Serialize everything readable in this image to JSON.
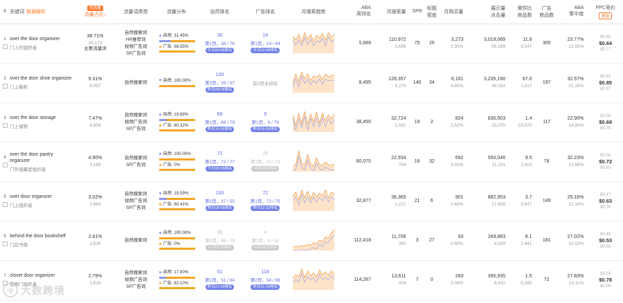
{
  "header": {
    "col_idx": "#",
    "col_keyword": "关键词",
    "col_keyword_link": "数据解析",
    "col_share_badge": "内流量",
    "col_share": "流量占比",
    "col_share_sort": "↓",
    "col_type": "流量词类型",
    "col_dist": "流量分布",
    "col_natural_rank": "自然排名",
    "col_ad_rank": "广告排名",
    "col_trend": "月搜索趋势",
    "col_aba": "ABA\n周排名",
    "col_search": "月搜索量",
    "col_spr": "SPR",
    "col_title_density": "标题\n密度",
    "col_purchase": "月购买量",
    "col_impressions": "展示量\n点击量",
    "col_product_ratio": "需供比\n商品数",
    "col_ad_products": "广告\n商品数",
    "col_aba_concentration": "ABA\n集中度",
    "col_ppc": "PPC竞价",
    "col_ppc_btn": "精准"
  },
  "rows": [
    {
      "idx": "1",
      "kw_en": "over the door organizer",
      "kw_cn": "门上的组织者",
      "share": "38.71%",
      "share_sub": "25,173",
      "share_note": "主要流量词",
      "types": [
        "自然搜索词",
        "HR推荐词",
        "视频广告词",
        "SP广告词"
      ],
      "nat_label": "自然: 31.45%",
      "ad_label": "广告: 68.55%",
      "nat_pct": 31.45,
      "nat_rank": "36",
      "nat_rank_page": "第1页，36 / 76",
      "nat_pill": "今日09:08排名",
      "ad_rank": "14",
      "ad_rank_page": "第1页，14 / 64",
      "ad_pill": "今日02:08排名",
      "trend": [
        18,
        14,
        20,
        12,
        22,
        15,
        20,
        13,
        19,
        16,
        21,
        14,
        22,
        17,
        20
      ],
      "aba": "5,689",
      "search": "110,972",
      "search_sub": "3,699",
      "spr": "75",
      "density": "25",
      "purchase": "3,273",
      "purchase_sub": "2.95%",
      "imp": "3,019,069",
      "imp_sub": "55,199",
      "ratio": "11.6",
      "ratio_sub": "9,547",
      "ad_products": "305",
      "conc": "23.77%",
      "conc_sub": "12.55%",
      "ppc_top": "$0.46",
      "ppc_mid": "$0.64",
      "ppc_bottom": "$0.77"
    },
    {
      "idx": "2",
      "kw_en": "over the door shoe organizer",
      "kw_cn": "门上鞋柜",
      "share": "9.31%",
      "share_sub": "6,057",
      "share_note": "",
      "types": [
        "自然搜索词"
      ],
      "nat_label": "自然: 100.00%",
      "ad_label": "",
      "nat_pct": 100,
      "nat_rank": "100",
      "nat_rank_page": "第3页，39 / 57",
      "nat_pill": "昨日08:08排名",
      "ad_rank": "",
      "ad_rank_page": "前3页无排名",
      "ad_pill": "",
      "trend": [
        10,
        20,
        12,
        22,
        15,
        20,
        13,
        18,
        16,
        19,
        14,
        20,
        17,
        18,
        19
      ],
      "aba": "8,495",
      "search": "128,357",
      "search_sub": "4,279",
      "spr": "140",
      "density": "34",
      "purchase": "6,161",
      "purchase_sub": "4.80%",
      "imp": "3,235,190",
      "imp_sub": "49,154",
      "ratio": "67.0",
      "ratio_sub": "1,917",
      "ad_products": "197",
      "conc": "32.57%",
      "conc_sub": "21.20%",
      "ppc_top": "$0.63",
      "ppc_mid": "$0.85",
      "ppc_bottom": "$0.97"
    },
    {
      "idx": "3",
      "kw_en": "over the door storage",
      "kw_cn": "门上储物",
      "share": "7.47%",
      "share_sub": "4,856",
      "share_note": "",
      "types": [
        "自然搜索词",
        "视频广告词",
        "SP广告词"
      ],
      "nat_label": "自然: 19.68%",
      "ad_label": "广告: 80.32%",
      "nat_pct": 19.68,
      "nat_rank": "68",
      "nat_rank_page": "第1页，68 / 79",
      "nat_pill": "昨日15:56排名",
      "ad_rank": "9",
      "ad_rank_page": "第1页，9 / 79",
      "ad_pill": "昨日15:56排名",
      "trend": [
        20,
        8,
        22,
        10,
        24,
        9,
        21,
        12,
        23,
        11,
        22,
        13,
        20,
        15,
        21
      ],
      "aba": "38,455",
      "search": "32,724",
      "search_sub": "1,091",
      "spr": "19",
      "density": "2",
      "purchase": "824",
      "purchase_sub": "2.52%",
      "imp": "830,503",
      "imp_sub": "15,075",
      "ratio": "1.4",
      "ratio_sub": "23,070",
      "ad_products": "117",
      "conc": "22.90%",
      "conc_sub": "14.80%",
      "ppc_top": "$0.56",
      "ppc_mid": "$0.69",
      "ppc_bottom": "$0.76"
    },
    {
      "idx": "4",
      "kw_en": "over the door pantry organizer",
      "kw_cn": "门外储藏室组织者",
      "share": "4.90%",
      "share_sub": "3,188",
      "share_note": "",
      "types": [
        "自然搜索词",
        "SP广告词"
      ],
      "nat_label": "自然: 100.00%",
      "ad_label": "广告: 0%",
      "nat_pct": 100,
      "nat_rank": "72",
      "nat_rank_page": "第1页，72 / 77",
      "nat_pill": "今日09:08排名",
      "ad_rank": "25",
      "ad_rank_page": "第1页，25 / 71",
      "ad_pill": "06月29日排名",
      "trend": [
        8,
        10,
        30,
        12,
        9,
        25,
        11,
        8,
        20,
        10,
        9,
        14,
        10,
        9,
        11
      ],
      "aba": "60,070",
      "search": "22,934",
      "search_sub": "764",
      "spr": "16",
      "density": "32",
      "purchase": "692",
      "purchase_sub": "3.02%",
      "imp": "550,046",
      "imp_sub": "11,101",
      "ratio": "9.5",
      "ratio_sub": "2,403",
      "ad_products": "78",
      "conc": "32.23%",
      "conc_sub": "12.68%",
      "ppc_top": "$0.58",
      "ppc_mid": "$0.72",
      "ppc_bottom": "$0.80"
    },
    {
      "idx": "5",
      "kw_en": "over door organizer",
      "kw_cn": "门上组织者",
      "share": "3.02%",
      "share_sub": "1,963",
      "share_note": "",
      "types": [
        "自然搜索词",
        "视频广告词",
        "SP广告词"
      ],
      "nat_label": "自然: 19.59%",
      "ad_label": "广告: 80.41%",
      "nat_pct": 19.59,
      "nat_rank": "100",
      "nat_rank_page": "第2页，37 / 55",
      "nat_pill": "昨日08:08排名",
      "ad_rank": "72",
      "ad_rank_page": "第1页，72 / 75",
      "ad_pill": "昨日22:32排名",
      "trend": [
        15,
        20,
        12,
        22,
        14,
        21,
        13,
        20,
        15,
        19,
        16,
        22,
        14,
        20,
        18
      ],
      "aba": "32,877",
      "search": "36,365",
      "search_sub": "1,212",
      "spr": "21",
      "density": "6",
      "purchase": "901",
      "purchase_sub": "2.48%",
      "imp": "882,953",
      "imp_sub": "17,456",
      "ratio": "3.7",
      "ratio_sub": "9,847",
      "ad_products": "149",
      "conc": "25.16%",
      "conc_sub": "12.15%",
      "ppc_top": "$0.47",
      "ppc_mid": "$0.63",
      "ppc_bottom": "$0.76"
    },
    {
      "idx": "6",
      "kw_en": "behind the door bookshelf",
      "kw_cn": "门后书架",
      "share": "2.81%",
      "share_sub": "1,826",
      "share_note": "",
      "types": [
        "自然搜索词"
      ],
      "nat_label": "自然: 100.00%",
      "ad_label": "广告: 0%",
      "nat_pct": 100,
      "nat_rank": "65",
      "nat_rank_page": "第1页，65 / 79",
      "nat_pill": "07月01日排名",
      "ad_rank": "4",
      "ad_rank_page": "第1页，4 / 53",
      "ad_pill": "06月19日排名",
      "trend": [
        4,
        5,
        4,
        6,
        5,
        7,
        6,
        9,
        8,
        12,
        10,
        16,
        14,
        20,
        24
      ],
      "aba": "112,418",
      "search": "11,706",
      "search_sub": "390",
      "spr": "3",
      "density": "27",
      "purchase": "93",
      "purchase_sub": "0.80%",
      "imp": "269,883",
      "imp_sub": "4,929",
      "ratio": "8.1",
      "ratio_sub": "1,441",
      "ad_products": "181",
      "conc": "27.02%",
      "conc_sub": "10.52%",
      "ppc_top": "$0.48",
      "ppc_mid": "$0.53",
      "ppc_bottom": "$0.59"
    },
    {
      "idx": "7",
      "kw_en": "closet door organizer",
      "kw_cn": "壁橱门组织者",
      "share": "2.79%",
      "share_sub": "1,816",
      "share_note": "",
      "types": [
        "自然搜索词",
        "视频广告词",
        "SP广告词"
      ],
      "nat_label": "自然: 17.90%",
      "ad_label": "广告: 82.10%",
      "nat_pct": 17.9,
      "nat_rank": "51",
      "nat_rank_page": "第1页，51 / 64",
      "nat_pill": "昨日21:34排名",
      "ad_rank": "118",
      "ad_rank_page": "第2页，54 / 56",
      "ad_pill": "昨日21:34排名",
      "trend": [
        12,
        16,
        14,
        22,
        13,
        20,
        15,
        18,
        14,
        21,
        16,
        19,
        15,
        20,
        17
      ],
      "aba": "114,287",
      "search": "13,611",
      "search_sub": "454",
      "spr": "7",
      "density": "0",
      "purchase": "283",
      "purchase_sub": "2.08%",
      "imp": "395,935",
      "imp_sub": "6,432",
      "ratio": "1.5",
      "ratio_sub": "9,392",
      "ad_products": "72",
      "conc": "27.83%",
      "conc_sub": "13.11%",
      "ppc_top": "$0.59",
      "ppc_mid": "$0.78",
      "ppc_bottom": "$0.98"
    }
  ],
  "watermark": {
    "logo": "卡",
    "text": "大数跨境"
  },
  "colors": {
    "accent": "#ff7a2f",
    "rank": "#5b6be0",
    "natural_bar": "#8d96e8",
    "ad_bar": "#f5a623",
    "trend_line": "#f0a050",
    "trend_fill": "#fde3c8",
    "trend_line2": "#8d96e8"
  }
}
